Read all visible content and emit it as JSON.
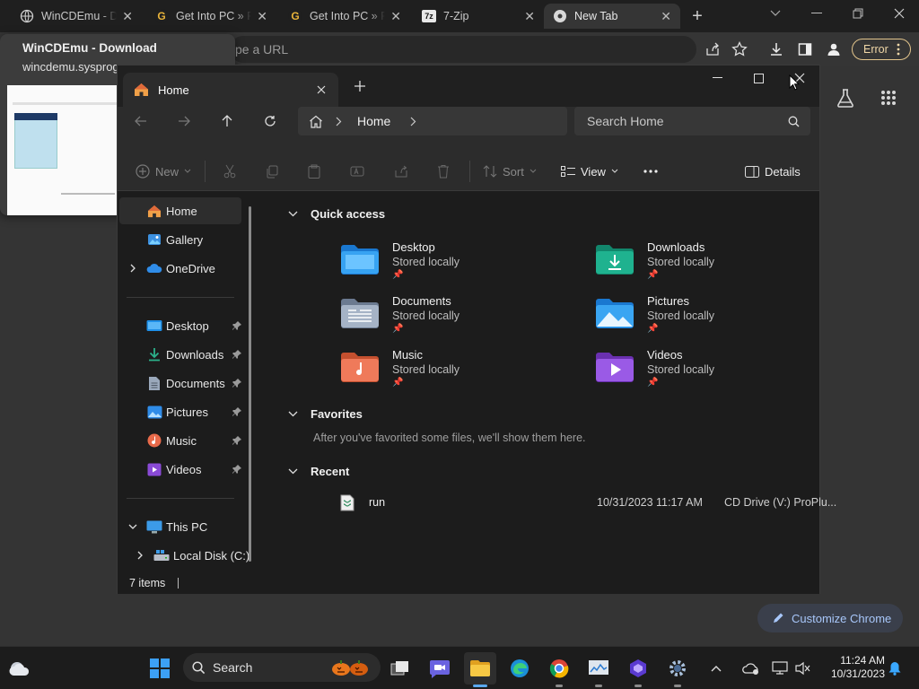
{
  "chrome": {
    "tabs": [
      {
        "title": "WinCDEmu - Do",
        "icon": "globe-icon"
      },
      {
        "title": "Get Into PC » Pl",
        "icon": "get-into-pc-icon"
      },
      {
        "title": "Get Into PC » Pl",
        "icon": "get-into-pc-icon"
      },
      {
        "title": "7-Zip",
        "icon": "7zip-icon"
      },
      {
        "title": "New Tab",
        "icon": "chrome-icon"
      }
    ],
    "new_tab_symbol": "+",
    "omnibox_placeholder": "pe a URL",
    "error_label": "Error",
    "hovercard": {
      "title": "WinCDEmu - Download",
      "url": "wincdemu.sysprog"
    },
    "customize_label": "Customize Chrome"
  },
  "explorer": {
    "tab_title": "Home",
    "breadcrumb": "Home",
    "search_placeholder": "Search Home",
    "commands": {
      "new": "New",
      "sort": "Sort",
      "view": "View",
      "details": "Details"
    },
    "sidebar": {
      "top": [
        {
          "label": "Home",
          "icon": "home-icon"
        },
        {
          "label": "Gallery",
          "icon": "gallery-icon"
        },
        {
          "label": "OneDrive",
          "icon": "onedrive-icon"
        }
      ],
      "pinned": [
        {
          "label": "Desktop",
          "icon": "desktop-folder-icon"
        },
        {
          "label": "Downloads",
          "icon": "downloads-folder-icon"
        },
        {
          "label": "Documents",
          "icon": "documents-folder-icon"
        },
        {
          "label": "Pictures",
          "icon": "pictures-folder-icon"
        },
        {
          "label": "Music",
          "icon": "music-folder-icon"
        },
        {
          "label": "Videos",
          "icon": "videos-folder-icon"
        }
      ],
      "this_pc": "This PC",
      "local_disk": "Local Disk (C:)"
    },
    "quick_access": {
      "header": "Quick access",
      "items": [
        {
          "name": "Desktop",
          "sub": "Stored locally",
          "color": "#1e8fe8"
        },
        {
          "name": "Downloads",
          "sub": "Stored locally",
          "color": "#1aa68a"
        },
        {
          "name": "Documents",
          "sub": "Stored locally",
          "color": "#7f8fa6"
        },
        {
          "name": "Pictures",
          "sub": "Stored locally",
          "color": "#1e8fe8"
        },
        {
          "name": "Music",
          "sub": "Stored locally",
          "color": "#e86a4a"
        },
        {
          "name": "Videos",
          "sub": "Stored locally",
          "color": "#8a4ad6"
        }
      ]
    },
    "favorites": {
      "header": "Favorites",
      "empty_text": "After you've favorited some files, we'll show them here."
    },
    "recent": {
      "header": "Recent",
      "items": [
        {
          "name": "run",
          "date": "10/31/2023 11:17 AM",
          "location": "CD Drive (V:) ProPlu..."
        }
      ]
    },
    "status": "7 items"
  },
  "taskbar": {
    "search_label": "Search",
    "time": "11:24 AM",
    "date": "10/31/2023"
  }
}
